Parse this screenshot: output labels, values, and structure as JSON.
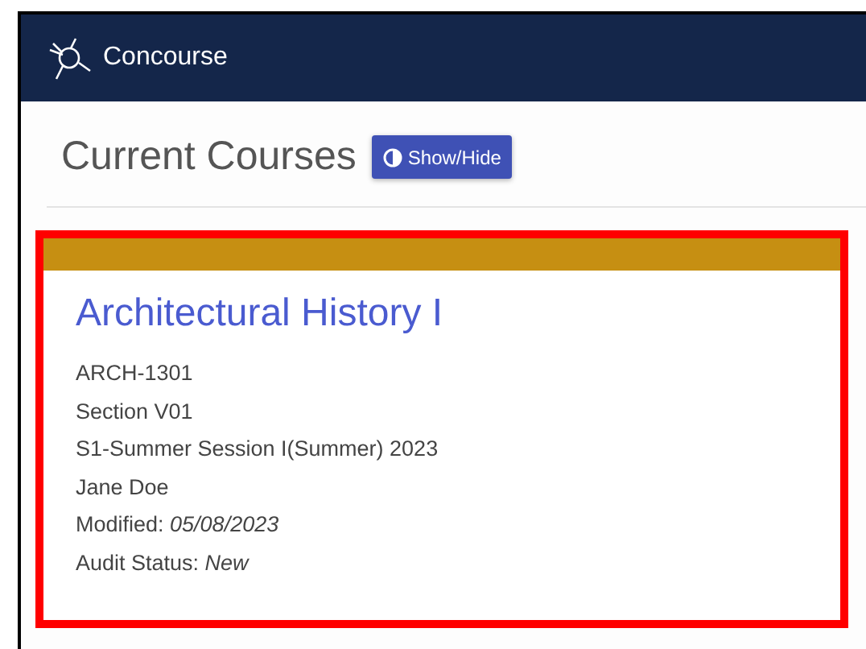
{
  "header": {
    "brand": "Concourse"
  },
  "page": {
    "title": "Current Courses",
    "toggle_button": "Show/Hide"
  },
  "course_card": {
    "highlighted": true,
    "title": "Architectural History I",
    "details": [
      "ARCH-1301",
      "Section V01",
      "S1-Summer Session I(Summer) 2023",
      "Jane Doe",
      "Modified: *05/08/2023*",
      "Audit Status: *New*"
    ]
  }
}
